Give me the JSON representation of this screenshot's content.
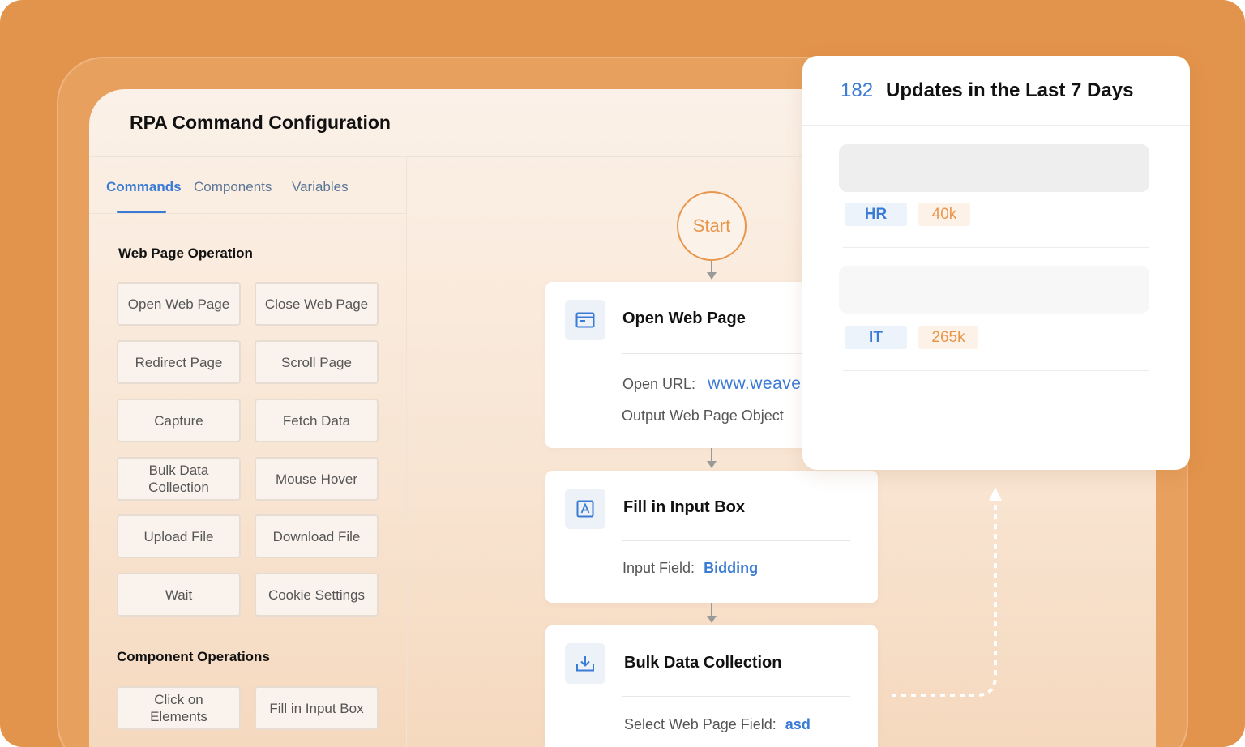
{
  "app": {
    "title": "RPA Command Configuration"
  },
  "sidebar": {
    "tabs": [
      {
        "label": "Commands",
        "active": true
      },
      {
        "label": "Components",
        "active": false
      },
      {
        "label": "Variables",
        "active": false
      }
    ],
    "sections": [
      {
        "title": "Web Page Operation",
        "buttons": [
          "Open Web Page",
          "Close Web Page",
          "Redirect Page",
          "Scroll Page",
          "Capture",
          "Fetch Data",
          "Bulk Data Collection",
          "Mouse Hover",
          "Upload File",
          "Download File",
          "Wait",
          "Cookie Settings"
        ]
      },
      {
        "title": "Component Operations",
        "buttons": [
          "Click on Elements",
          "Fill in Input Box"
        ]
      }
    ]
  },
  "flow": {
    "start_label": "Start",
    "nodes": [
      {
        "icon": "browser-window-icon",
        "title": "Open Web Page",
        "fields": [
          {
            "label": "Open URL:",
            "value": "www.weaver"
          },
          {
            "label": "Output Web Page Object",
            "value": ""
          }
        ]
      },
      {
        "icon": "text-input-icon",
        "title": "Fill in Input Box",
        "fields": [
          {
            "label": "Input Field:",
            "value": "Bidding"
          }
        ]
      },
      {
        "icon": "download-icon",
        "title": "Bulk Data Collection",
        "fields": [
          {
            "label": "Select Web Page Field:",
            "value": "asd"
          }
        ]
      }
    ]
  },
  "updates": {
    "count": "182",
    "title": "Updates in the Last 7 Days",
    "items": [
      {
        "dept": "HR",
        "value": "40k"
      },
      {
        "dept": "IT",
        "value": "265k"
      }
    ]
  },
  "colors": {
    "frame": "#e3944c",
    "accent_blue": "#3a7bd5",
    "accent_orange": "#e9964d"
  }
}
